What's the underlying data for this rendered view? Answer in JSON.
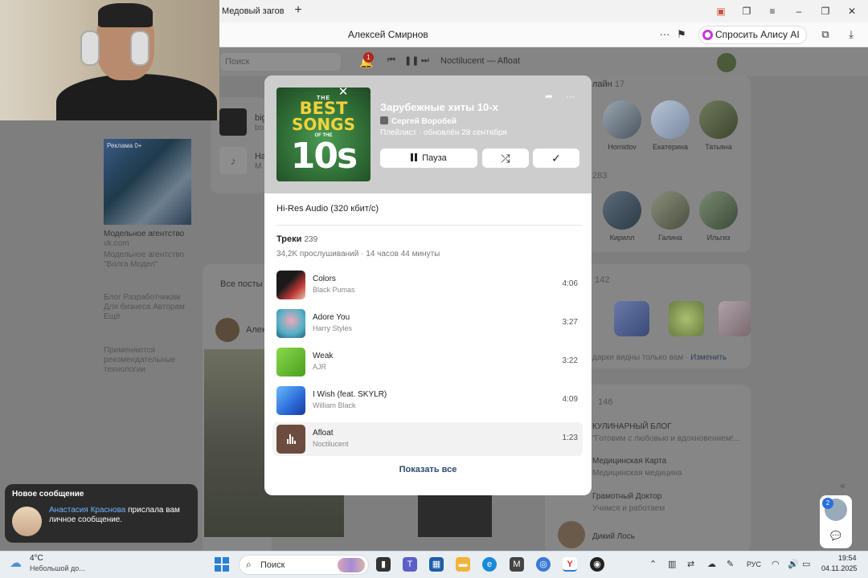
{
  "browser": {
    "tab_title": "Медовый загов",
    "new_tab": "+",
    "page_title": "Алексей Смирнов",
    "ask_alisa": "Спросить Алису AI",
    "dots": "···"
  },
  "page": {
    "search_placeholder": "Поиск",
    "notifications_badge": "1",
    "now_playing": "Noctilucent — Afloat",
    "left_track_1_title": "big",
    "left_track_1_sub": "bo",
    "left_track_2_title": "На",
    "left_track_2_sub": "М",
    "ad_label": "Реклама 0+",
    "ad_title": "Модельное агентство",
    "ad_domain": "vk.com",
    "ad_desc": "Модельное агентство \"Волга Модел\"",
    "footer_links": "Блог   Разработчикам\nДля бизнеса   Авторам\nЕщё",
    "recommendations": "Применяются рекомендательные технологии",
    "all_posts_tab": "Все посты",
    "post_author_partial": "Алек",
    "online_label": "лайн",
    "online_count": "17",
    "friends": [
      {
        "name": "Homidov"
      },
      {
        "name": "Екатерина"
      },
      {
        "name": "Татьяна"
      }
    ],
    "followers_count": "283",
    "followers": [
      {
        "name": "Кирилл"
      },
      {
        "name": "Галина"
      },
      {
        "name": "Ильгиз"
      }
    ],
    "gifts_count": "142",
    "gifts_note": "дарки видны только вам",
    "gifts_change": "Изменить",
    "groups_count": "146",
    "groups": [
      {
        "name": "КУЛИНАРНЫЙ БЛОГ",
        "sub": "\"Готовим с любовью и вдохновением!..."
      },
      {
        "name": "Медицинская Карта",
        "sub": "Медицинская медицина"
      },
      {
        "name": "Грамотный Доктор",
        "sub": "Учимся и работаем"
      },
      {
        "name": "Дикий Лось",
        "sub": ""
      }
    ]
  },
  "notification": {
    "title": "Новое сообщение",
    "sender": "Анастасия Краснова",
    "text": " прислала вам личное сообщение."
  },
  "side_widget": {
    "badge": "2",
    "chevron": "«"
  },
  "playlist": {
    "cover": {
      "the": "THE",
      "best": "BEST",
      "songs": "SONGS",
      "of_the": "OF THE",
      "number": "10s"
    },
    "title": "Зарубежные хиты 10-х",
    "author": "Сергей Воробей",
    "meta": "Плейлист · обновлён 28 сентября",
    "pause_label": "Пауза",
    "quality": "Hi-Res Audio (320 кбит/с)",
    "tracks_label": "Треки",
    "tracks_count": "239",
    "listens": "34,2K прослушиваний",
    "duration_total": "14 часов 44 минуты",
    "show_all": "Показать все",
    "tracks": [
      {
        "name": "Colors",
        "artist": "Black Pumas",
        "duration": "4:06",
        "color": "#3a2a20"
      },
      {
        "name": "Adore You",
        "artist": "Harry Styles",
        "duration": "3:27",
        "color": "#4fb0c8"
      },
      {
        "name": "Weak",
        "artist": "AJR",
        "duration": "3:22",
        "color": "#6cc238"
      },
      {
        "name": "I Wish (feat. SKYLR)",
        "artist": "William Black",
        "duration": "4:09",
        "color": "#3b86e8"
      },
      {
        "name": "Afloat",
        "artist": "Noctilucent",
        "duration": "1:23",
        "color": "#6b4c3e",
        "active": true
      }
    ]
  },
  "taskbar": {
    "temperature": "4°C",
    "weather": "Небольшой до...",
    "search": "Поиск",
    "lang": "РУС",
    "time": "19:54",
    "date": "04.11.2025"
  },
  "colors": {
    "accent_link": "#2c4a6e",
    "alisa": "#c23bd4",
    "badge_red": "#b3261e",
    "notification_bg": "#2b2b2b"
  }
}
